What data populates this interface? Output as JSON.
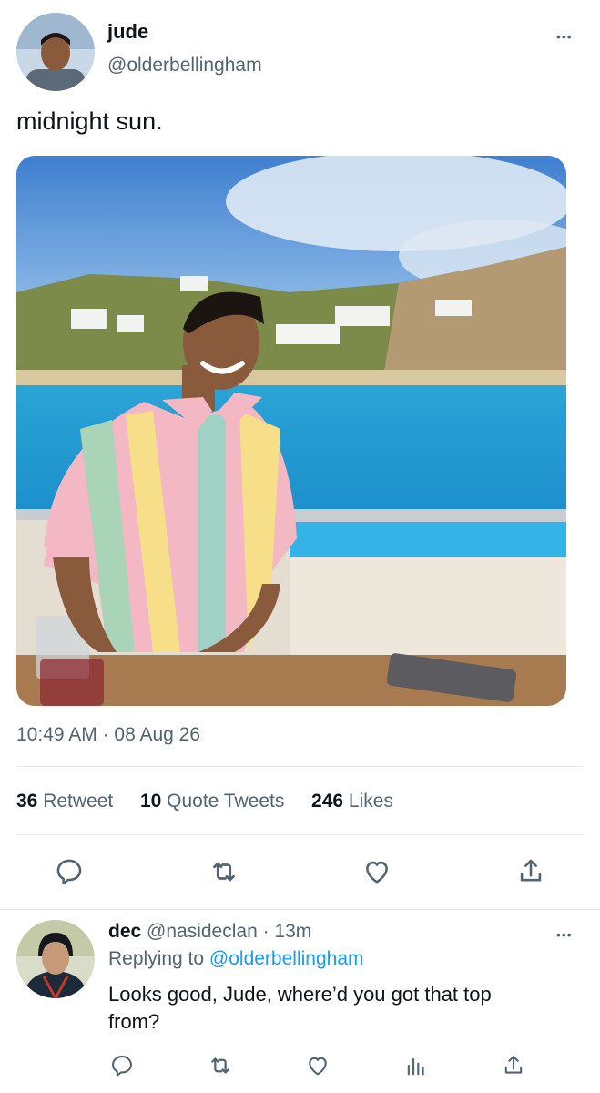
{
  "tweet": {
    "author_name": "jude",
    "author_handle": "@olderbellingham",
    "more_glyph": "•••",
    "text": "midnight sun.",
    "time": "10:49 AM",
    "separator": "·",
    "date": "08 Aug 26",
    "stats": {
      "retweets_count": "36",
      "retweets_label": "Retweet",
      "quotes_count": "10",
      "quotes_label": "Quote Tweets",
      "likes_count": "246",
      "likes_label": "Likes"
    },
    "actions": [
      "reply-icon",
      "retweet-icon",
      "like-icon",
      "share-icon"
    ]
  },
  "reply": {
    "author_name": "dec",
    "author_handle": "@nasideclan",
    "separator": "·",
    "time": "13m",
    "more_glyph": "•••",
    "replying_to_label": "Replying to",
    "replying_to_handle": "@olderbellingham",
    "text_line1": "Looks good, Jude, where’d you got that top",
    "text_line2": "from?",
    "actions": [
      "reply-icon",
      "retweet-icon",
      "like-icon",
      "analytics-icon",
      "share-icon"
    ]
  },
  "colors": {
    "accent": "#1d9bf0",
    "secondary_text": "#536471",
    "primary_text": "#0f1419"
  }
}
